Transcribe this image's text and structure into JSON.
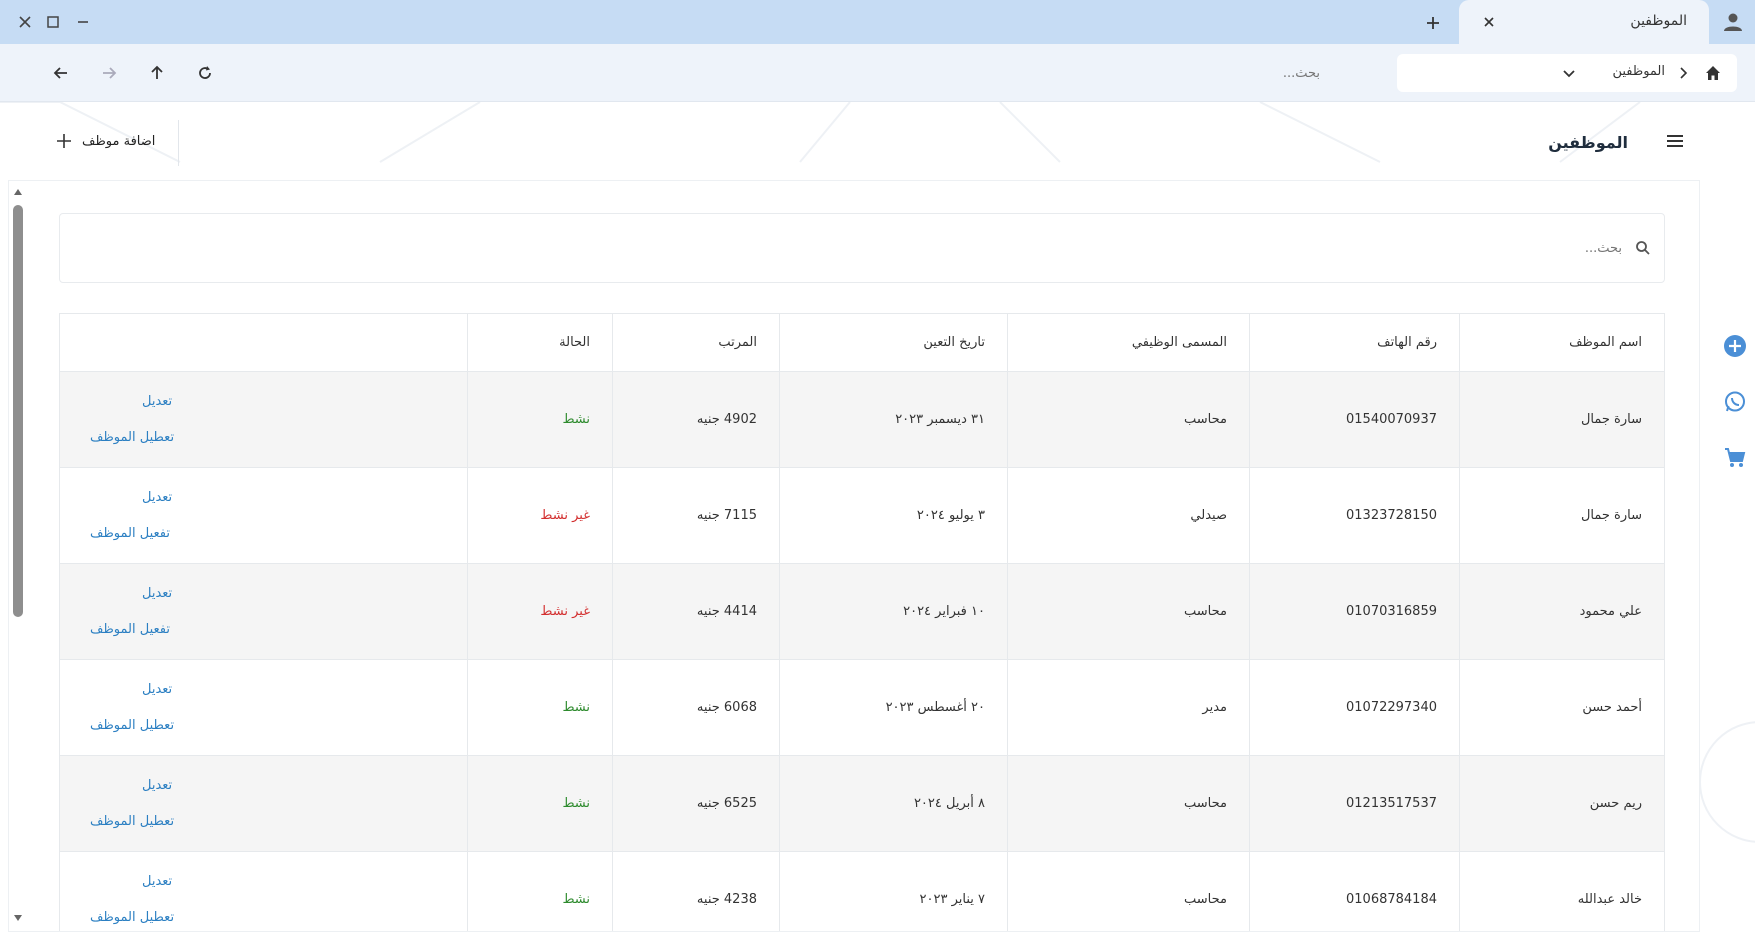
{
  "window": {
    "tab_title": "الموظفين"
  },
  "nav": {
    "breadcrumb_label": "الموظفين",
    "search_placeholder": "بحث..."
  },
  "page": {
    "title": "الموظفين",
    "add_button_label": "اضافة موظف"
  },
  "table_search": {
    "placeholder": "بحث..."
  },
  "table": {
    "headers": {
      "name": "اسم الموظف",
      "phone": "رقم الهاتف",
      "job": "المسمى الوظيفي",
      "date": "تاريخ التعين",
      "salary": "المرتب",
      "status": "الحالة",
      "actions": ""
    },
    "rows": [
      {
        "name": "سارة جمال",
        "phone": "01540070937",
        "job": "محاسب",
        "date": "٣١ ديسمبر ٢٠٢٣",
        "salary": "4902 جنيه",
        "status": "نشط",
        "edit": "تعديل",
        "toggle": "تعطيل الموظف"
      },
      {
        "name": "سارة جمال",
        "phone": "01323728150",
        "job": "صيدلي",
        "date": "٣ يوليو ٢٠٢٤",
        "salary": "7115 جنيه",
        "status": "غير نشط",
        "edit": "تعديل",
        "toggle": "تفعيل الموظف"
      },
      {
        "name": "علي محمود",
        "phone": "01070316859",
        "job": "محاسب",
        "date": "١٠ فبراير ٢٠٢٤",
        "salary": "4414 جنيه",
        "status": "غير نشط",
        "edit": "تعديل",
        "toggle": "تفعيل الموظف"
      },
      {
        "name": "أحمد حسن",
        "phone": "01072297340",
        "job": "مدير",
        "date": "٢٠ أغسطس ٢٠٢٣",
        "salary": "6068 جنيه",
        "status": "نشط",
        "edit": "تعديل",
        "toggle": "تعطيل الموظف"
      },
      {
        "name": "ريم حسن",
        "phone": "01213517537",
        "job": "محاسب",
        "date": "٨ أبريل ٢٠٢٤",
        "salary": "6525 جنيه",
        "status": "نشط",
        "edit": "تعديل",
        "toggle": "تعطيل الموظف"
      },
      {
        "name": "خالد عبدالله",
        "phone": "01068784184",
        "job": "محاسب",
        "date": "٧ يناير ٢٠٢٣",
        "salary": "4238 جنيه",
        "status": "نشط",
        "edit": "تعديل",
        "toggle": "تعطيل الموظف"
      }
    ]
  },
  "colors": {
    "active": "#2e8b2e",
    "inactive": "#d32f2f",
    "link": "#2b7fc2",
    "tabstrip": "#c6dcf4",
    "rail_icon": "#4b8fd6"
  },
  "icons": {
    "rail": [
      "add-circle-icon",
      "whatsapp-icon",
      "cart-icon"
    ]
  }
}
